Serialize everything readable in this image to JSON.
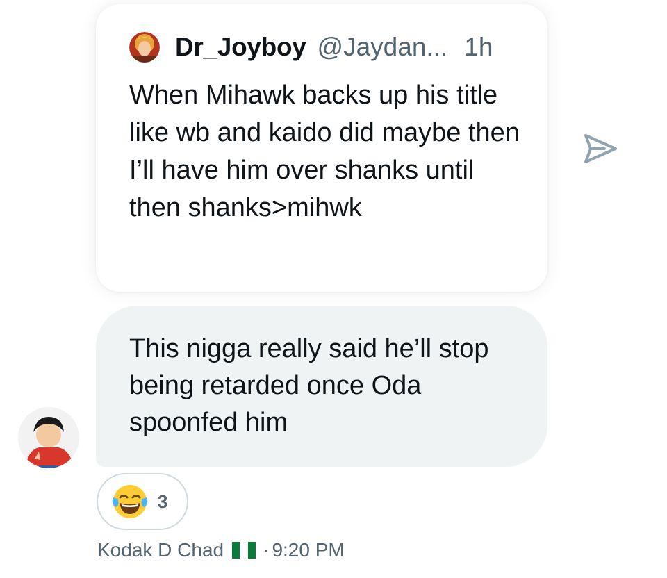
{
  "quoted_message": {
    "display_name": "Dr_Joyboy",
    "handle": "@Jaydan...",
    "time": "1h",
    "text": "When Mihawk backs up his title like wb and kaido did maybe then I’ll have him over shanks until then shanks>mihwk",
    "avatar_icon": "user-avatar-icon"
  },
  "message": {
    "text": "This nigga really said he’ll stop being retarded once Oda spoonfed him",
    "bubble_color": "#eff3f4"
  },
  "reaction": {
    "emoji_icon": "face-with-tears-of-joy-emoji",
    "count": "3"
  },
  "meta": {
    "sender_name": "Kodak D Chad",
    "flag_icon": "nigeria-flag-icon",
    "separator": "·",
    "time": "9:20 PM"
  },
  "colors": {
    "text_primary": "#0f1419",
    "text_secondary": "#536471",
    "share_icon": "#8fa3b1"
  }
}
